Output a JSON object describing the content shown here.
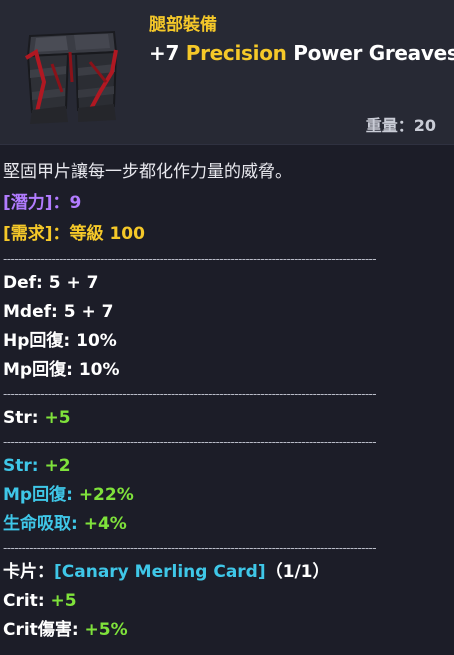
{
  "header": {
    "category": "腿部裝備",
    "name_prefix": "+7 ",
    "name_modifier": "Precision",
    "name_suffix": " Power Greaves",
    "weight_label": "重量：",
    "weight_value": "20",
    "icon": "armored-greaves-icon"
  },
  "description": "堅固甲片讓每一步都化作力量的威脅。",
  "potential": {
    "label": "[潛力]：",
    "value": "9"
  },
  "requirement": {
    "label": "[需求]：",
    "value": "等級 100"
  },
  "divider": "----------------------------------------------------------------------------------------------------",
  "base_stats": [
    {
      "label": "Def: ",
      "value": "5 + 7"
    },
    {
      "label": "Mdef: ",
      "value": "5 + 7"
    },
    {
      "label": "Hp回復: ",
      "value": "10%"
    },
    {
      "label": "Mp回復: ",
      "value": "10%"
    }
  ],
  "bonus_stats": [
    {
      "label": "Str: ",
      "value": "+5"
    }
  ],
  "enchant_stats": [
    {
      "label": "Str: ",
      "value": "+2"
    },
    {
      "label": "Mp回復: ",
      "value": "+22%"
    },
    {
      "label": "生命吸取: ",
      "value": "+4%"
    }
  ],
  "card": {
    "label": "卡片：",
    "name": "[Canary Merling Card]",
    "count": "（1/1）",
    "stats": [
      {
        "label": "Crit: ",
        "value": "+5"
      },
      {
        "label": "Crit傷害: ",
        "value": "+5%"
      }
    ]
  },
  "colors": {
    "gold": "#f5c829",
    "purple": "#b27cff",
    "green": "#7fe23b",
    "cyan": "#3fc7e8",
    "background": "#1c1d28",
    "header_background": "#272934"
  }
}
